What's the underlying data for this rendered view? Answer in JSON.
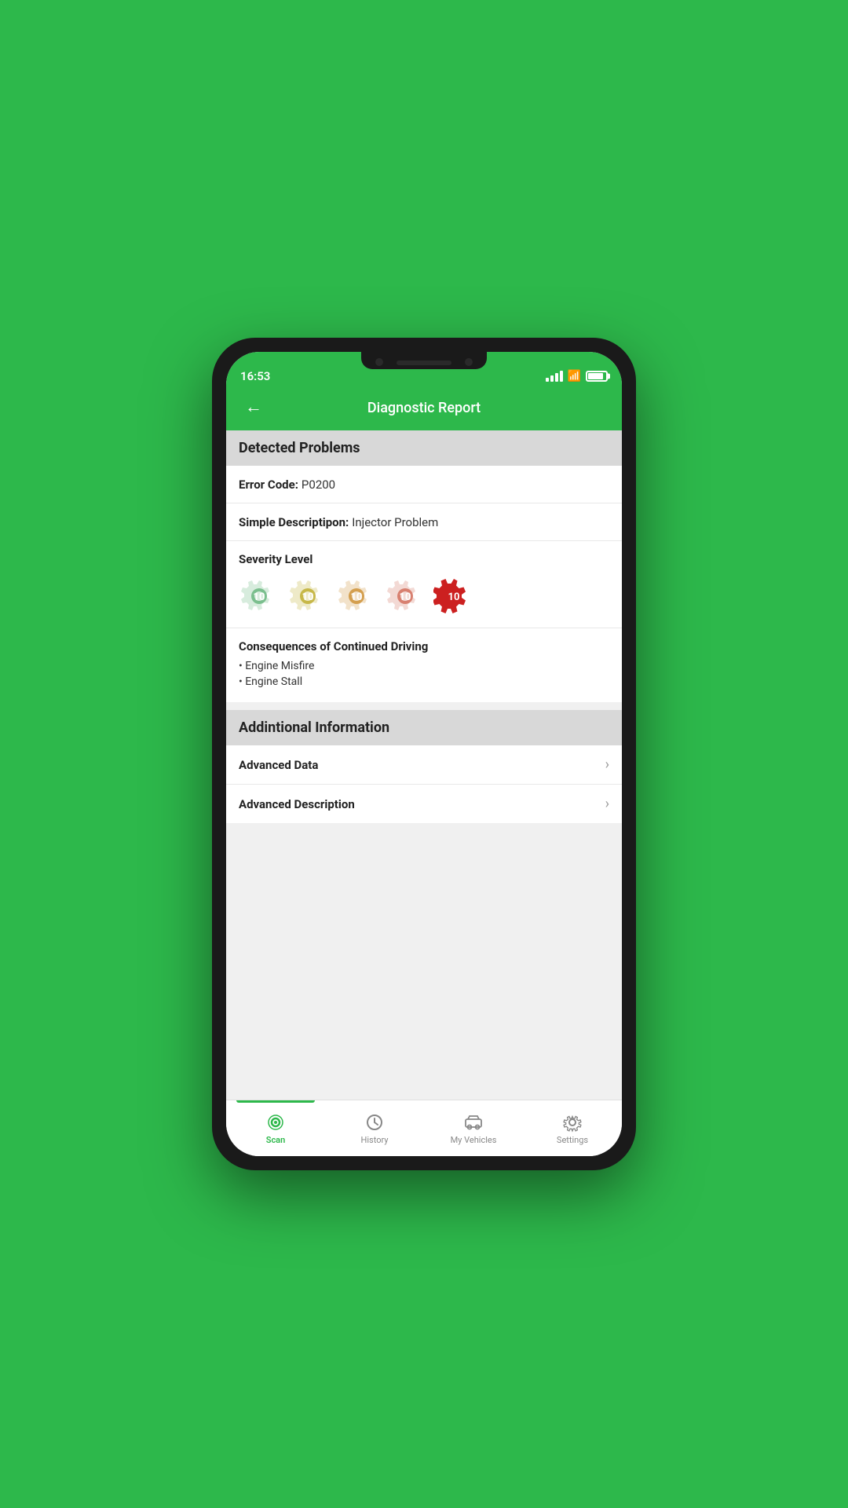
{
  "status": {
    "time": "16:53"
  },
  "header": {
    "title": "Diagnostic Report",
    "back_label": "←"
  },
  "detected_problems": {
    "section_title": "Detected Problems",
    "error_code_label": "Error Code:",
    "error_code_value": "P0200",
    "simple_desc_label": "Simple Descriptipon:",
    "simple_desc_value": "Injector Problem",
    "severity_label": "Severity Level",
    "severity_active": 5,
    "severity_colors": [
      "#7cbf8e",
      "#c8b84a",
      "#d4a050",
      "#d88070",
      "#cc2020"
    ],
    "consequences_title": "Consequences of Continued Driving",
    "consequences": [
      "Engine Misfire",
      "Engine Stall"
    ]
  },
  "additional_info": {
    "section_title": "Addintional Information",
    "items": [
      {
        "label": "Advanced Data"
      },
      {
        "label": "Advanced Description"
      }
    ]
  },
  "bottom_nav": {
    "items": [
      {
        "label": "Scan",
        "active": true
      },
      {
        "label": "History",
        "active": false
      },
      {
        "label": "My Vehicles",
        "active": false
      },
      {
        "label": "Settings",
        "active": false
      }
    ]
  }
}
